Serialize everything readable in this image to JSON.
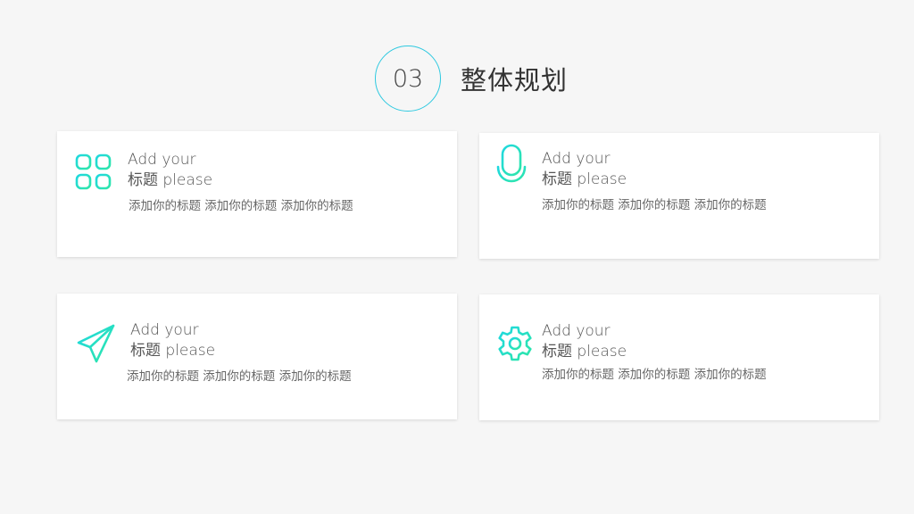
{
  "header": {
    "number": "03",
    "title": "整体规划"
  },
  "accent_color": "#24e0c0",
  "cards": [
    {
      "icon": "apps-grid-icon",
      "title_line1": "Add your",
      "title_line2": "标题 please",
      "description": "添加你的标题 添加你的标题 添加你的标题"
    },
    {
      "icon": "microphone-icon",
      "title_line1": "Add your",
      "title_line2": "标题 please",
      "description": "添加你的标题 添加你的标题 添加你的标题"
    },
    {
      "icon": "paper-plane-icon",
      "title_line1": "Add your",
      "title_line2": "标题 please",
      "description": "添加你的标题 添加你的标题 添加你的标题"
    },
    {
      "icon": "gear-icon",
      "title_line1": "Add your",
      "title_line2": "标题 please",
      "description": "添加你的标题 添加你的标题 添加你的标题"
    }
  ]
}
